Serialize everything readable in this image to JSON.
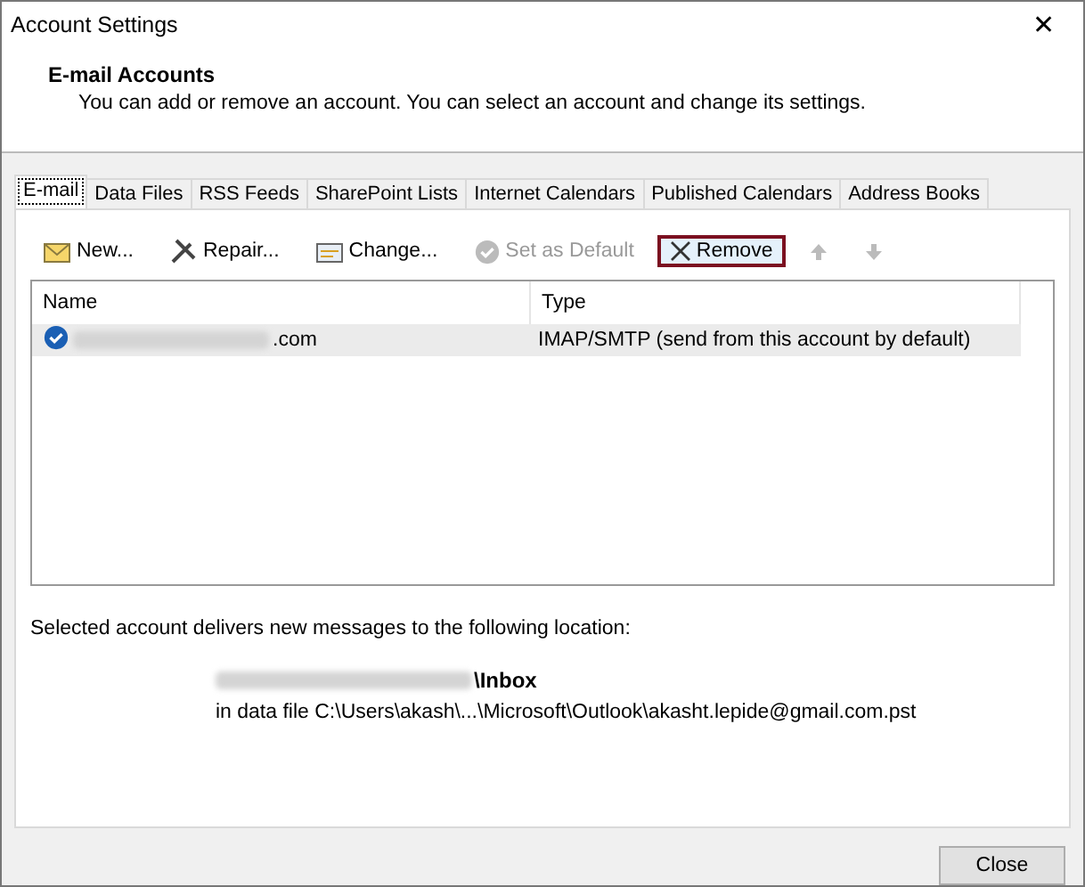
{
  "window": {
    "title": "Account Settings",
    "close": "✕"
  },
  "header": {
    "title": "E-mail Accounts",
    "subtitle": "You can add or remove an account. You can select an account and change its settings."
  },
  "tabs": [
    {
      "label": "E-mail",
      "selected": true
    },
    {
      "label": "Data Files",
      "selected": false
    },
    {
      "label": "RSS Feeds",
      "selected": false
    },
    {
      "label": "SharePoint Lists",
      "selected": false
    },
    {
      "label": "Internet Calendars",
      "selected": false
    },
    {
      "label": "Published Calendars",
      "selected": false
    },
    {
      "label": "Address Books",
      "selected": false
    }
  ],
  "toolbar": [
    {
      "kind": "new",
      "label": "New...",
      "disabled": false,
      "highlighted": false
    },
    {
      "kind": "repair",
      "label": "Repair...",
      "disabled": false,
      "highlighted": false
    },
    {
      "kind": "change",
      "label": "Change...",
      "disabled": false,
      "highlighted": false
    },
    {
      "kind": "default",
      "label": "Set as Default",
      "disabled": true,
      "highlighted": false
    },
    {
      "kind": "remove",
      "label": "Remove",
      "disabled": false,
      "highlighted": true
    },
    {
      "kind": "up",
      "disabled": true,
      "highlighted": false
    },
    {
      "kind": "down",
      "disabled": true,
      "highlighted": false
    }
  ],
  "table": {
    "columns": [
      "Name",
      "Type"
    ],
    "rows": [
      {
        "name_suffix": ".com",
        "type": "IMAP/SMTP (send from this account by default)",
        "is_default": true,
        "selected": true
      }
    ]
  },
  "delivery": {
    "label": "Selected account delivers new messages to the following location:",
    "folder": "\\Inbox",
    "data_file": "in data file C:\\Users\\akash\\...\\Microsoft\\Outlook\\akasht.lepide@gmail.com.pst"
  },
  "buttons": [
    {
      "label": "Close"
    }
  ]
}
